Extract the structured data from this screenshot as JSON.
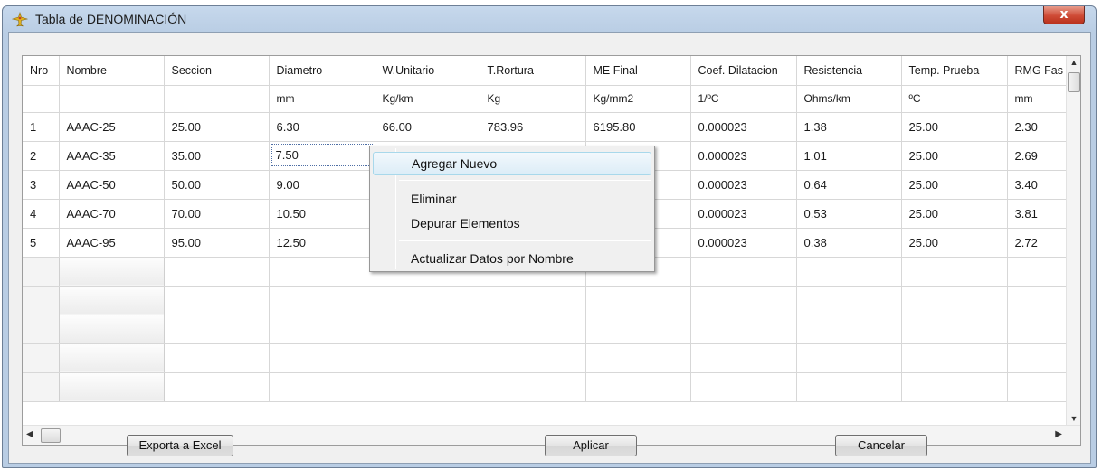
{
  "window": {
    "title": "Tabla de DENOMINACIÓN",
    "close_label": "x"
  },
  "grid": {
    "columns": [
      "Nro",
      "Nombre",
      "Seccion",
      "Diametro",
      "W.Unitario",
      "T.Rortura",
      "ME Final",
      "Coef. Dilatacion",
      "Resistencia",
      "Temp. Prueba",
      "RMG Fas"
    ],
    "units": [
      "",
      "",
      "",
      "mm",
      "Kg/km",
      "Kg",
      "Kg/mm2",
      "1/ºC",
      "Ohms/km",
      "ºC",
      "mm"
    ],
    "rows": [
      [
        "1",
        "AAAC-25",
        "25.00",
        "6.30",
        "66.00",
        "783.96",
        "6195.80",
        "0.000023",
        "1.38",
        "25.00",
        "2.30"
      ],
      [
        "2",
        "AAAC-35",
        "35.00",
        "7.50",
        "",
        "",
        "",
        "0.000023",
        "1.01",
        "25.00",
        "2.69"
      ],
      [
        "3",
        "AAAC-50",
        "50.00",
        "9.00",
        "",
        "",
        "",
        "0.000023",
        "0.64",
        "25.00",
        "3.40"
      ],
      [
        "4",
        "AAAC-70",
        "70.00",
        "10.50",
        "",
        "",
        "",
        "0.000023",
        "0.53",
        "25.00",
        "3.81"
      ],
      [
        "5",
        "AAAC-95",
        "95.00",
        "12.50",
        "",
        "",
        "",
        "0.000023",
        "0.38",
        "25.00",
        "2.72"
      ]
    ],
    "blank_rows": 5,
    "editing_cell": {
      "row": 1,
      "col": 3
    }
  },
  "context_menu": {
    "items": [
      {
        "label": "Agregar Nuevo",
        "highlighted": true
      },
      {
        "label": "Eliminar"
      },
      {
        "label": "Depurar Elementos"
      },
      {
        "label": "Actualizar Datos por Nombre"
      }
    ]
  },
  "buttons": {
    "export": "Exporta a Excel",
    "apply": "Aplicar",
    "cancel": "Cancelar"
  },
  "colors": {
    "title_gradient": "#b9cde4",
    "close_button": "#cf4b36",
    "menu_highlight": "#dcedf7"
  },
  "icons": {
    "title": "plane-icon",
    "close": "close-icon"
  }
}
